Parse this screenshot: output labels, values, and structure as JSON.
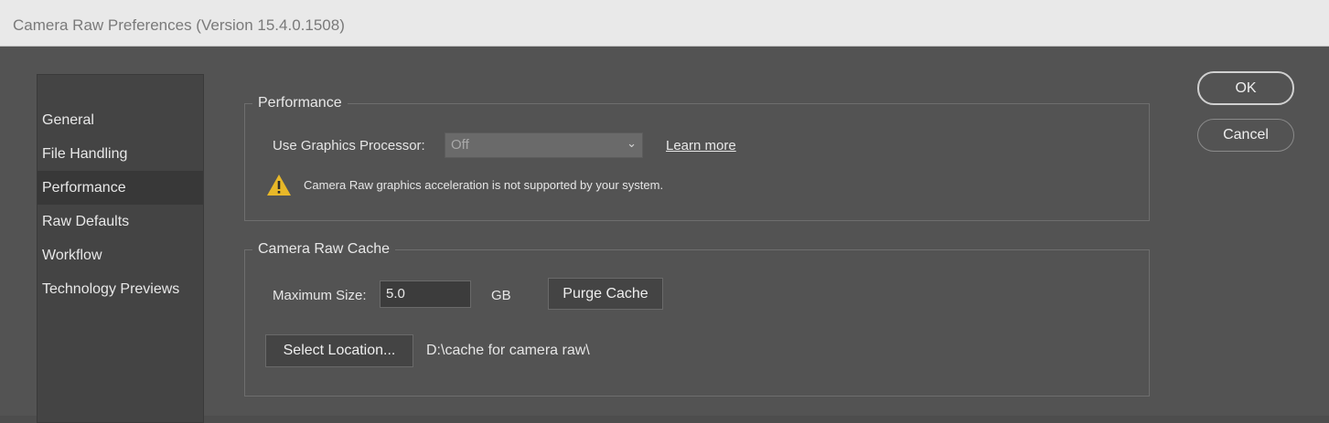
{
  "window": {
    "title": "Camera Raw Preferences (Version 15.4.0.1508)"
  },
  "sidebar": {
    "items": [
      {
        "label": "General"
      },
      {
        "label": "File Handling"
      },
      {
        "label": "Performance",
        "selected": true
      },
      {
        "label": "Raw Defaults"
      },
      {
        "label": "Workflow"
      },
      {
        "label": "Technology Previews"
      }
    ]
  },
  "performance": {
    "group_title": "Performance",
    "gpu_label": "Use Graphics Processor:",
    "gpu_value": "Off",
    "learn_more": "Learn more",
    "warning": "Camera Raw graphics acceleration is not supported by your system."
  },
  "cache": {
    "group_title": "Camera Raw Cache",
    "max_size_label": "Maximum Size:",
    "max_size_value": "5.0",
    "unit": "GB",
    "purge_button": "Purge Cache",
    "select_location_button": "Select Location...",
    "location_path": "D:\\cache for camera raw\\"
  },
  "buttons": {
    "ok": "OK",
    "cancel": "Cancel"
  },
  "colors": {
    "dialog_bg": "#535353",
    "sidebar_bg": "#444444",
    "selected_bg": "#383838",
    "warning_yellow": "#e8b828"
  },
  "icons": {
    "warning": "warning-triangle-icon",
    "dropdown": "chevron-down-icon"
  }
}
